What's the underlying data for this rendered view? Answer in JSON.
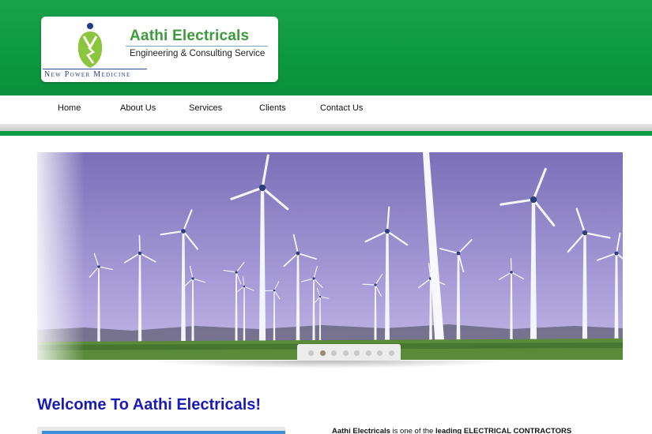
{
  "brand": {
    "name": "Aathi Electricals",
    "subtitle": "Engineering & Consulting Service",
    "tagline": "New Power Medicine"
  },
  "nav": {
    "items": [
      {
        "label": "Home"
      },
      {
        "label": "About Us"
      },
      {
        "label": "Services"
      },
      {
        "label": "Clients"
      },
      {
        "label": "Contact Us"
      }
    ]
  },
  "slider": {
    "image": "wind-turbines-photo",
    "dot_count": 8,
    "active_index": 1
  },
  "main": {
    "heading": "Welcome To Aathi Electricals!",
    "intro_name": "Aathi Electricals",
    "intro_mid": " is one of the ",
    "intro_bold": "leading ELECTRICAL CONTRACTORS"
  },
  "colors": {
    "header_green": "#0d9a43",
    "brand_green": "#3c9a3a",
    "heading_blue": "#1a1ab8"
  }
}
